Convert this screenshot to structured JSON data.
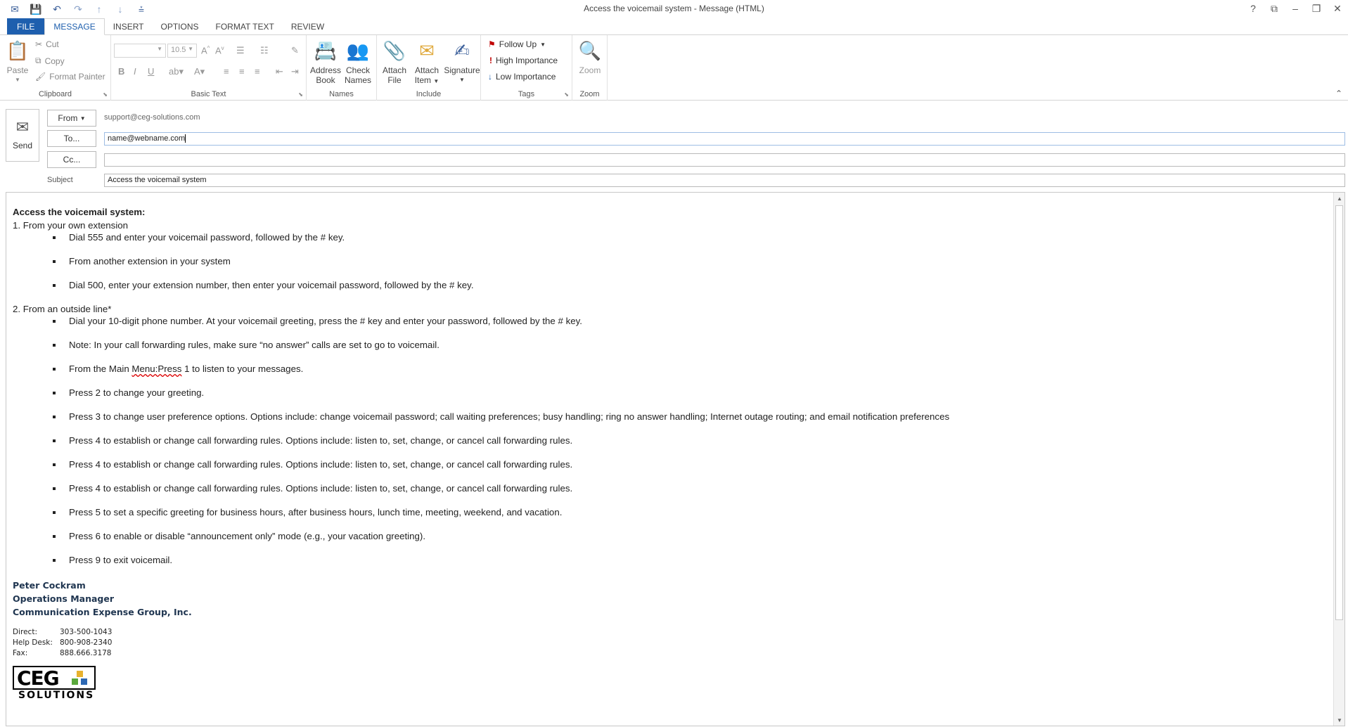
{
  "window": {
    "title": "Access the voicemail system - Message (HTML)",
    "controls": [
      "?",
      "⧉",
      "–",
      "❐",
      "✕"
    ]
  },
  "qat": {
    "icons": [
      "mail-icon",
      "save-icon",
      "undo-icon",
      "redo-icon",
      "up-arrow-icon",
      "down-arrow-icon",
      "customize-icon"
    ]
  },
  "tabs": [
    {
      "label": "FILE"
    },
    {
      "label": "MESSAGE"
    },
    {
      "label": "INSERT"
    },
    {
      "label": "OPTIONS"
    },
    {
      "label": "FORMAT TEXT"
    },
    {
      "label": "REVIEW"
    }
  ],
  "ribbon": {
    "clipboard": {
      "label": "Clipboard",
      "paste": "Paste",
      "cut": "Cut",
      "copy": "Copy",
      "format_painter": "Format Painter"
    },
    "basic_text": {
      "label": "Basic Text",
      "font_size": "10.5"
    },
    "names": {
      "label": "Names",
      "address_book_1": "Address",
      "address_book_2": "Book",
      "check_names_1": "Check",
      "check_names_2": "Names"
    },
    "include": {
      "label": "Include",
      "attach_file_1": "Attach",
      "attach_file_2": "File",
      "attach_item_1": "Attach",
      "attach_item_2": "Item",
      "signature": "Signature"
    },
    "tags": {
      "label": "Tags",
      "follow_up": "Follow Up",
      "high": "High Importance",
      "low": "Low Importance"
    },
    "zoom": {
      "label": "Zoom",
      "zoom": "Zoom"
    }
  },
  "header": {
    "send": "Send",
    "from_label": "From",
    "from_value": "support@ceg-solutions.com",
    "to_label": "To...",
    "to_value": "name@webname.com",
    "cc_label": "Cc...",
    "cc_value": "",
    "subject_label": "Subject",
    "subject_value": "Access the voicemail system"
  },
  "body": {
    "heading": "Access the voicemail system:",
    "section1": "1. From your own extension",
    "list1": [
      "Dial 555 and enter your voicemail password, followed by the # key.",
      "From another extension in your system",
      "Dial 500, enter your extension number, then enter your voicemail password, followed by the # key."
    ],
    "section2": "2. From an outside line*",
    "list2_0": "Dial your 10-digit phone number. At your voicemail greeting, press the # key and enter your password, followed by the # key.",
    "list2_1": "Note: In your call forwarding rules, make sure “no answer”  calls are set to go to voicemail.",
    "list2_2a": "From the Main ",
    "list2_2b": "Menu:Press",
    "list2_2c": " 1 to listen to your messages.",
    "list2_rest": [
      "Press 2 to change your greeting.",
      "Press 3 to change user preference options. Options include: change voicemail password; call waiting preferences; busy handling; ring no answer handling; Internet outage routing; and email notification preferences",
      "Press 4 to establish or change call forwarding rules. Options include: listen to, set, change, or cancel call forwarding rules.",
      "Press 4 to establish or change call forwarding rules. Options include: listen to, set, change, or cancel call forwarding rules.",
      "Press 4 to establish or change call forwarding rules. Options include: listen to, set, change, or cancel call forwarding rules.",
      "Press 5 to set a specific greeting for business hours, after business hours, lunch time, meeting, weekend, and vacation.",
      "Press 6 to enable or disable “announcement only” mode (e.g., your vacation greeting).",
      "Press 9 to exit voicemail."
    ],
    "signature": {
      "name": "Peter Cockram",
      "title": "Operations Manager",
      "company": "Communication Expense Group, Inc."
    },
    "contact": [
      {
        "label": "Direct:",
        "value": "303-500-1043"
      },
      {
        "label": "Help Desk:",
        "value": "800-908-2340"
      },
      {
        "label": "Fax:",
        "value": "888.666.3178"
      }
    ],
    "logo_text": "CEG",
    "logo_sub": "SOLUTIONS"
  },
  "colors": {
    "accent": "#1e5fae",
    "high_importance": "#c00000",
    "low_importance": "#1e5fae",
    "signature_text": "#1f3550"
  }
}
